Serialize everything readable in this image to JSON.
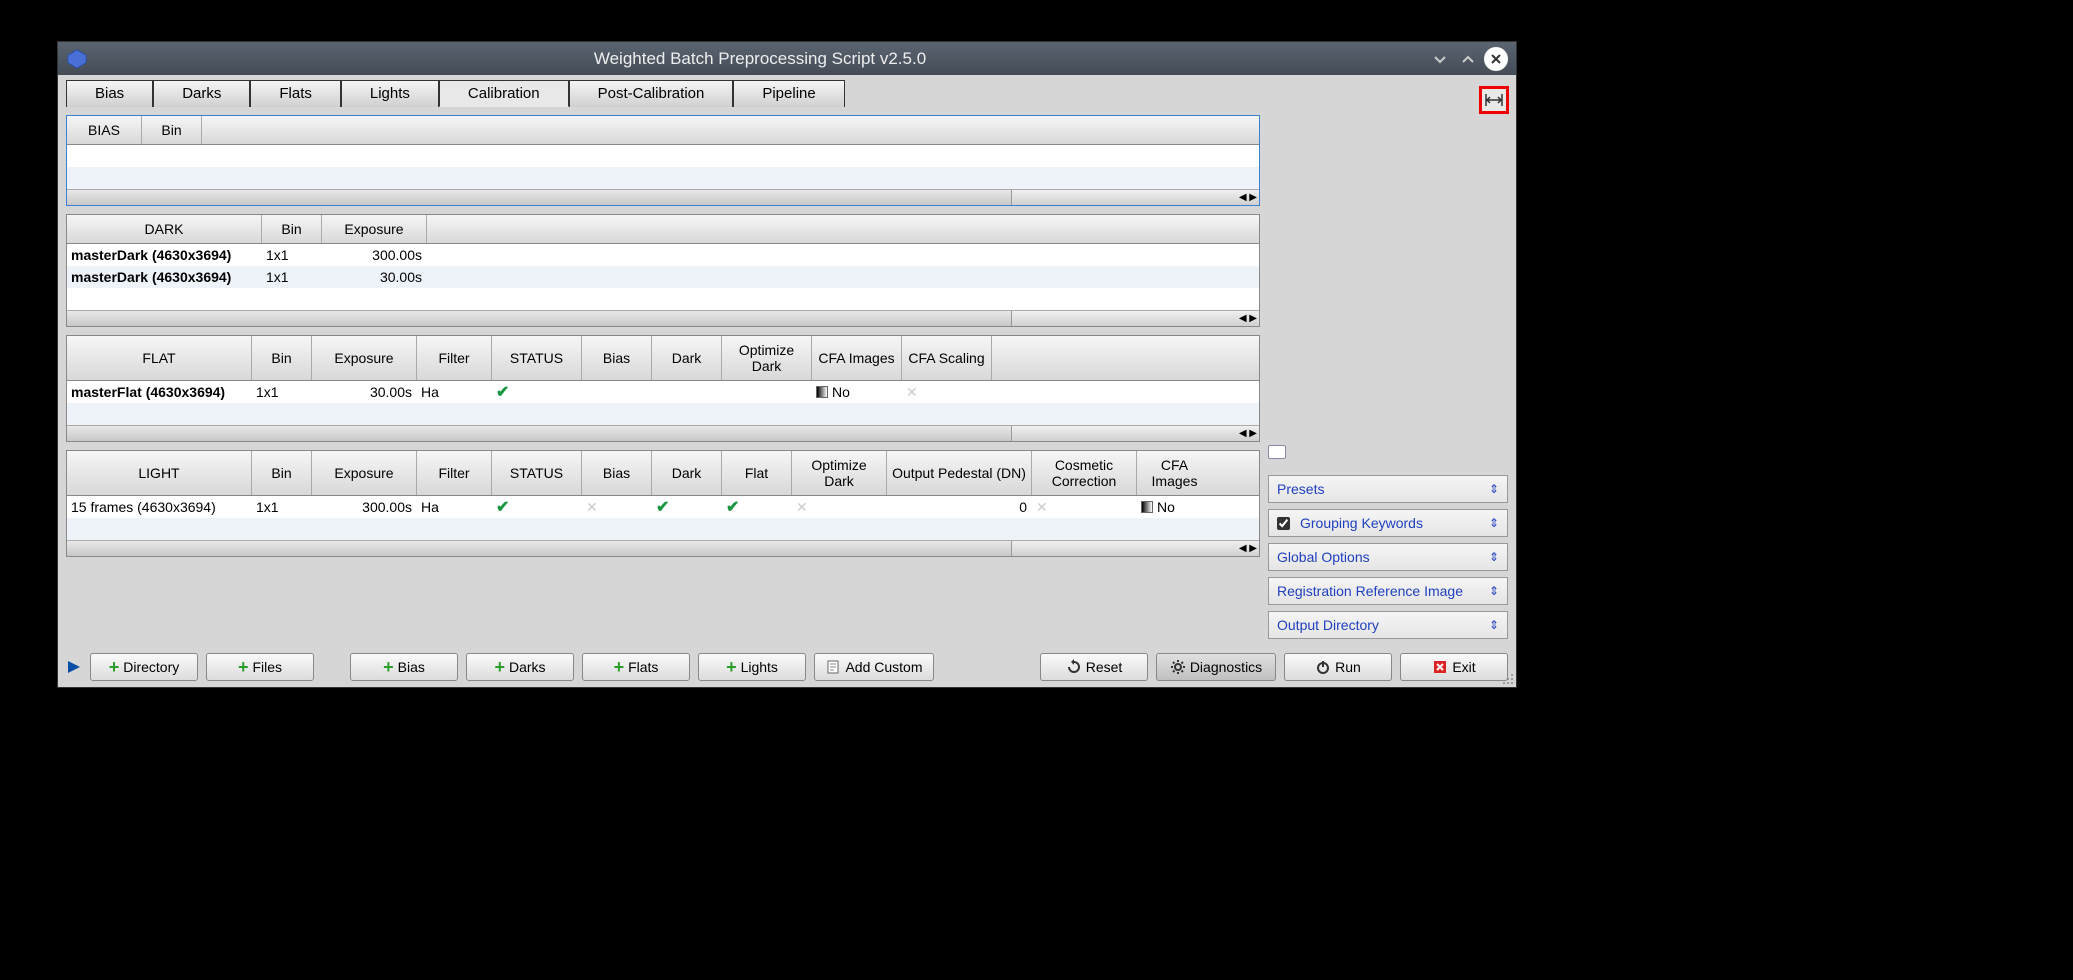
{
  "title": "Weighted Batch Preprocessing Script v2.5.0",
  "tabs": {
    "bias": "Bias",
    "darks": "Darks",
    "flats": "Flats",
    "lights": "Lights",
    "calibration": "Calibration",
    "post_calibration": "Post-Calibration",
    "pipeline": "Pipeline"
  },
  "bias_panel": {
    "headers": {
      "bias": "BIAS",
      "bin": "Bin"
    }
  },
  "dark_panel": {
    "headers": {
      "dark": "DARK",
      "bin": "Bin",
      "exposure": "Exposure"
    },
    "rows": [
      {
        "name": "masterDark (4630x3694)",
        "bin": "1x1",
        "exposure": "300.00s"
      },
      {
        "name": "masterDark (4630x3694)",
        "bin": "1x1",
        "exposure": "30.00s"
      }
    ]
  },
  "flat_panel": {
    "headers": {
      "flat": "FLAT",
      "bin": "Bin",
      "exposure": "Exposure",
      "filter": "Filter",
      "status": "STATUS",
      "bias": "Bias",
      "dark": "Dark",
      "opt_dark": "Optimize Dark",
      "cfa_images": "CFA Images",
      "cfa_scaling": "CFA Scaling"
    },
    "rows": [
      {
        "name": "masterFlat (4630x3694)",
        "bin": "1x1",
        "exposure": "30.00s",
        "filter": "Ha",
        "status": "check",
        "bias": "",
        "dark": "",
        "opt_dark": "",
        "cfa_images": "No",
        "cfa_scaling": "x"
      }
    ]
  },
  "light_panel": {
    "headers": {
      "light": "LIGHT",
      "bin": "Bin",
      "exposure": "Exposure",
      "filter": "Filter",
      "status": "STATUS",
      "bias": "Bias",
      "dark": "Dark",
      "flat": "Flat",
      "opt_dark": "Optimize Dark",
      "pedestal": "Output Pedestal (DN)",
      "cosmetic": "Cosmetic Correction",
      "cfa_images": "CFA Images"
    },
    "rows": [
      {
        "name": "15 frames (4630x3694)",
        "bin": "1x1",
        "exposure": "300.00s",
        "filter": "Ha",
        "status": "check",
        "bias": "x",
        "dark": "check",
        "flat": "check",
        "opt_dark": "x",
        "pedestal": "0",
        "cosmetic": "x",
        "cfa_images": "No"
      }
    ]
  },
  "side": {
    "presets": "Presets",
    "grouping": "Grouping Keywords",
    "global_options": "Global Options",
    "reg_ref": "Registration Reference Image",
    "output_dir": "Output Directory"
  },
  "buttons": {
    "directory": "Directory",
    "files": "Files",
    "bias": "Bias",
    "darks": "Darks",
    "flats": "Flats",
    "lights": "Lights",
    "add_custom": "Add Custom",
    "reset": "Reset",
    "diagnostics": "Diagnostics",
    "run": "Run",
    "exit": "Exit"
  }
}
